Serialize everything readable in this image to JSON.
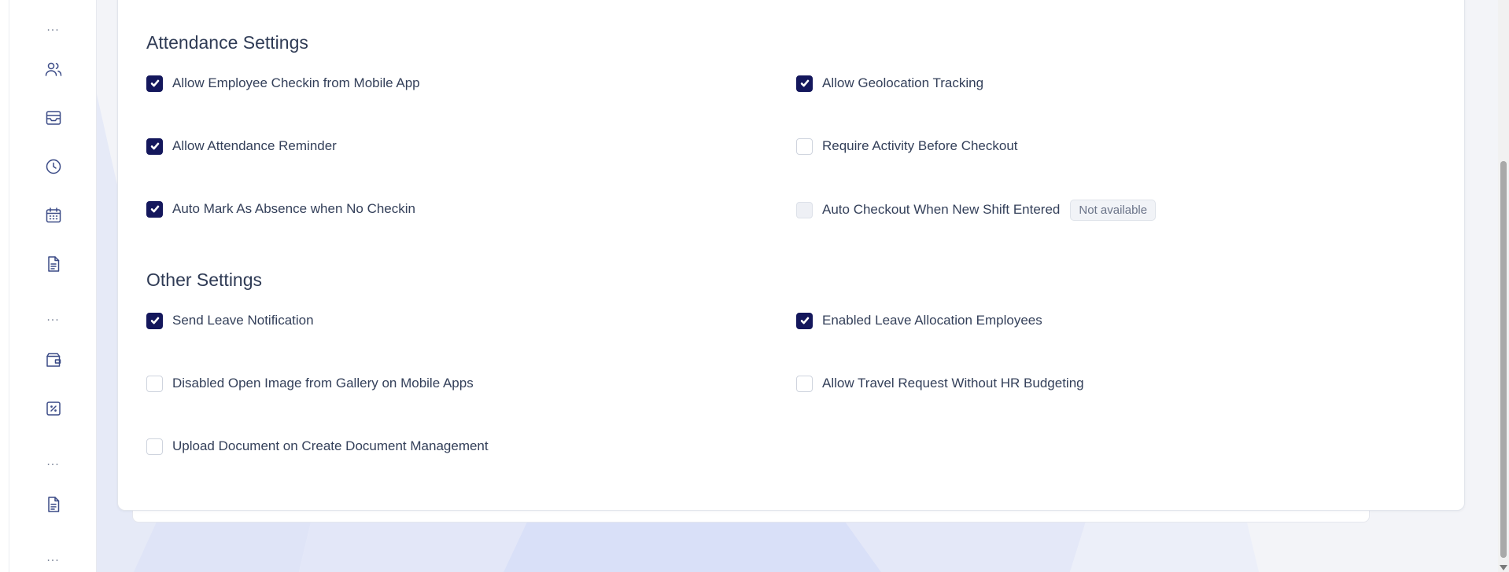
{
  "sidebar": {
    "items": [
      {
        "type": "dots",
        "label": "...",
        "icon": "ellipsis"
      },
      {
        "type": "icon",
        "icon": "users-icon"
      },
      {
        "type": "icon",
        "icon": "inbox-icon"
      },
      {
        "type": "icon",
        "icon": "clock-icon"
      },
      {
        "type": "icon",
        "icon": "calendar-icon"
      },
      {
        "type": "icon",
        "icon": "document-icon"
      },
      {
        "type": "dots",
        "label": "...",
        "icon": "ellipsis"
      },
      {
        "type": "icon",
        "icon": "wallet-icon"
      },
      {
        "type": "icon",
        "icon": "percent-tag-icon"
      },
      {
        "type": "dots",
        "label": "...",
        "icon": "ellipsis"
      },
      {
        "type": "icon",
        "icon": "document-icon"
      },
      {
        "type": "dots",
        "label": "...",
        "icon": "ellipsis"
      }
    ]
  },
  "attendance": {
    "title": "Attendance Settings",
    "options": [
      {
        "label": "Allow Employee Checkin from Mobile App",
        "checked": true,
        "disabled": false
      },
      {
        "label": "Allow Geolocation Tracking",
        "checked": true,
        "disabled": false
      },
      {
        "label": "Allow Attendance Reminder",
        "checked": true,
        "disabled": false
      },
      {
        "label": "Require Activity Before Checkout",
        "checked": false,
        "disabled": false
      },
      {
        "label": "Auto Mark As Absence when No Checkin",
        "checked": true,
        "disabled": false
      },
      {
        "label": "Auto Checkout When New Shift Entered",
        "checked": false,
        "disabled": true,
        "badge": "Not available"
      }
    ]
  },
  "other": {
    "title": "Other Settings",
    "options": [
      {
        "label": "Send Leave Notification",
        "checked": true,
        "disabled": false
      },
      {
        "label": "Enabled Leave Allocation Employees",
        "checked": true,
        "disabled": false
      },
      {
        "label": "Disabled Open Image from Gallery on Mobile Apps",
        "checked": false,
        "disabled": false
      },
      {
        "label": "Allow Travel Request Without HR Budgeting",
        "checked": false,
        "disabled": false
      },
      {
        "label": "Upload Document on Create Document Management",
        "checked": false,
        "disabled": false
      }
    ]
  },
  "colors": {
    "checked": "#14175c",
    "icon": "#3a4a86",
    "text": "#34405a"
  }
}
